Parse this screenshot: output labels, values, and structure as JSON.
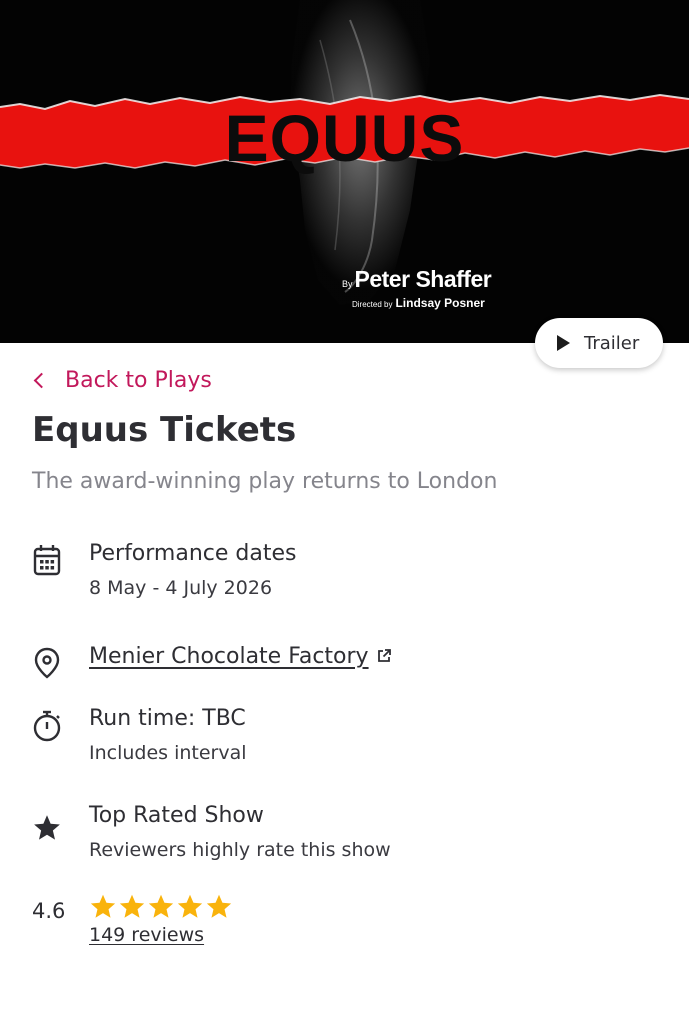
{
  "hero": {
    "title": "EQUUS",
    "by_prefix": "By",
    "author": "Peter Shaffer",
    "directed_prefix": "Directed by",
    "director": "Lindsay Posner",
    "accent_color": "#e8120f"
  },
  "trailer": {
    "label": "Trailer",
    "icon": "play-icon"
  },
  "nav": {
    "back_label": "Back to Plays",
    "back_icon": "chevron-left-icon",
    "link_color": "#c2185b"
  },
  "show": {
    "title": "Equus Tickets",
    "subtitle": "The award-winning play returns to London"
  },
  "details": {
    "dates": {
      "icon": "calendar-icon",
      "label": "Performance dates",
      "value": "8 May - 4 July 2026"
    },
    "venue": {
      "icon": "location-pin-icon",
      "label": "Menier Chocolate Factory",
      "link_icon": "external-link-icon"
    },
    "runtime": {
      "icon": "stopwatch-icon",
      "label": "Run time: TBC",
      "value": "Includes interval"
    },
    "rated": {
      "icon": "star-icon",
      "label": "Top Rated Show",
      "value": "Reviewers highly rate this show"
    }
  },
  "rating": {
    "score": "4.6",
    "stars_filled": 5,
    "stars_total": 5,
    "star_color": "#f9b30c",
    "reviews_label": "149 reviews"
  }
}
